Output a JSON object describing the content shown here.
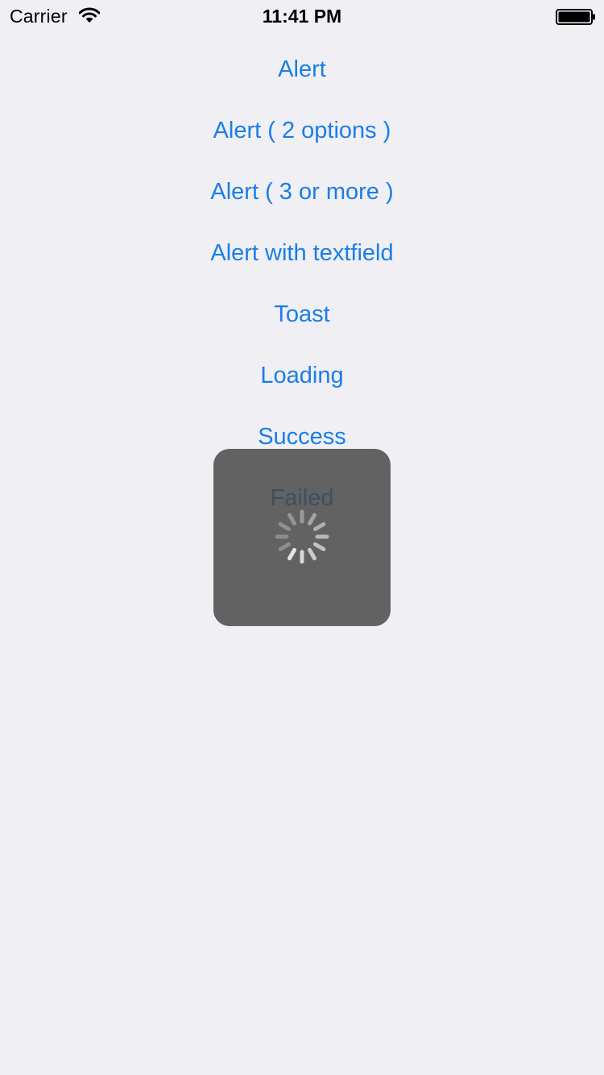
{
  "status_bar": {
    "carrier": "Carrier",
    "time": "11:41 PM",
    "wifi_icon": "wifi-icon",
    "battery_icon": "battery-icon"
  },
  "menu": {
    "items": [
      {
        "label": "Alert"
      },
      {
        "label": "Alert ( 2 options )"
      },
      {
        "label": "Alert ( 3 or more )"
      },
      {
        "label": "Alert with textfield"
      },
      {
        "label": "Toast"
      },
      {
        "label": "Loading"
      },
      {
        "label": "Success"
      },
      {
        "label": "Failed"
      }
    ]
  },
  "loading_hud": {
    "icon": "spinner-icon"
  },
  "colors": {
    "background": "#efeff4",
    "link": "#1a7ee6",
    "hud": "#464646"
  }
}
